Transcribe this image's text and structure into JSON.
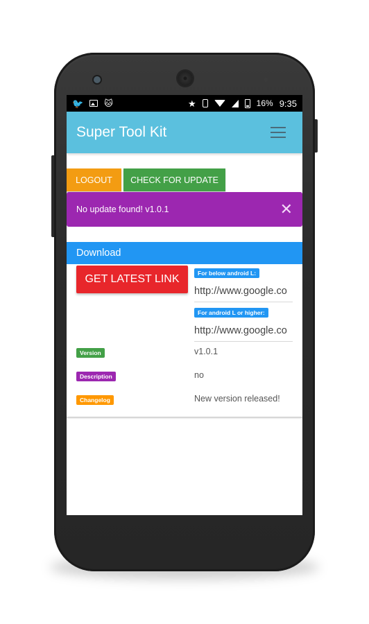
{
  "status_bar": {
    "battery": "16%",
    "time": "9:35",
    "icons_left": [
      "twitter-icon",
      "image-icon",
      "cat-icon"
    ],
    "icons_right": [
      "star-icon",
      "vibrate-icon",
      "wifi-icon",
      "signal-icon",
      "battery-icon"
    ]
  },
  "app_bar": {
    "title": "Super Tool Kit"
  },
  "actions": {
    "logout_label": "LOGOUT",
    "check_update_label": "CHECK FOR UPDATE"
  },
  "alert": {
    "message": "No update found! v1.0.1",
    "close_symbol": "✕"
  },
  "download": {
    "header": "Download",
    "latest_link_label": "GET LATEST LINK",
    "below_l_label": "For below android L:",
    "below_l_url": "http://www.google.co",
    "l_or_higher_label": "For android L or higher:",
    "l_or_higher_url": "http://www.google.co",
    "version_label": "Version",
    "version_value": "v1.0.1",
    "description_label": "Description",
    "description_value": "no",
    "changelog_label": "Changelog",
    "changelog_value": "New version released!"
  },
  "colors": {
    "app_bar": "#5bc0de",
    "logout": "#f39c12",
    "check_update": "#43a047",
    "alert": "#9c27b0",
    "download_header": "#2196f3",
    "latest_button": "#e8262b"
  }
}
